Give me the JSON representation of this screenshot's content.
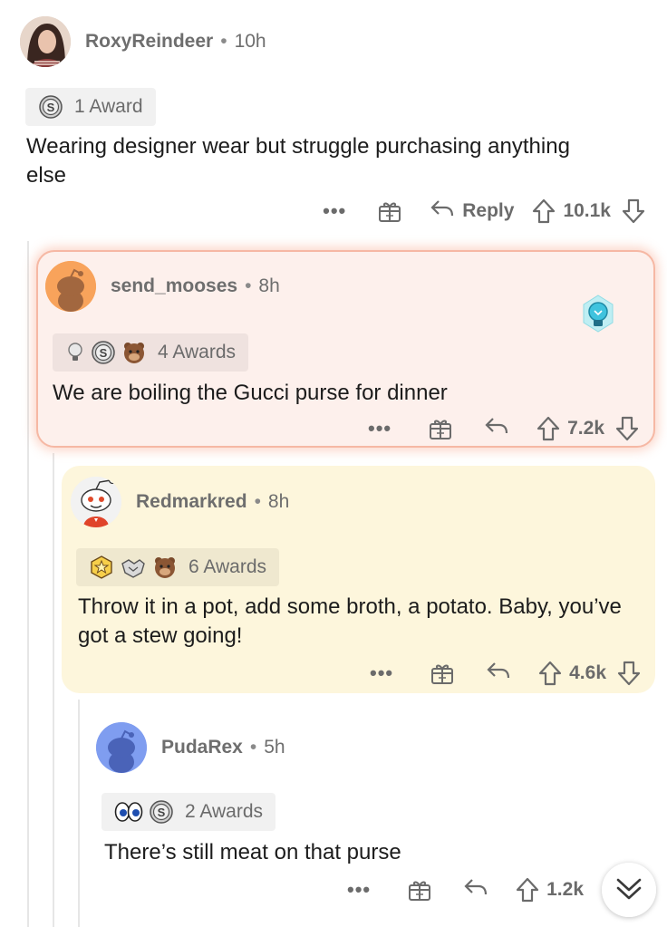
{
  "comments": [
    {
      "username": "RoxyReindeer",
      "time": "10h",
      "awards_label": "1 Award",
      "body": "Wearing designer wear but struggle purchasing anything else",
      "more": "•••",
      "reply_label": "Reply",
      "score": "10.1k"
    },
    {
      "username": "send_mooses",
      "time": "8h",
      "awards_label": "4 Awards",
      "body": "We are boiling the Gucci purse for dinner",
      "more": "•••",
      "score": "7.2k"
    },
    {
      "username": "Redmarkred",
      "time": "8h",
      "awards_label": "6 Awards",
      "body": "Throw it in a pot, add some broth, a potato. Baby, you’ve got a stew going!",
      "more": "•••",
      "score": "4.6k"
    },
    {
      "username": "PudaRex",
      "time": "5h",
      "awards_label": "2 Awards",
      "body": "There’s still meat on that purse",
      "more": "•••",
      "score": "1.2k"
    }
  ],
  "separator": "•",
  "colors": {
    "highlight_bg": "#fdf0ec",
    "highlight_border": "#f6b8a4",
    "yellow_bg": "#fdf6dc",
    "meta_gray": "#6e6e6e"
  },
  "icons": [
    "gift-icon",
    "reply-arrow-icon",
    "upvote-icon",
    "downvote-icon",
    "silver-award-icon",
    "bulb-award-icon",
    "bear-award-icon",
    "star-award-icon",
    "handshake-award-icon",
    "eyes-award-icon",
    "chevron-double-down-icon"
  ]
}
